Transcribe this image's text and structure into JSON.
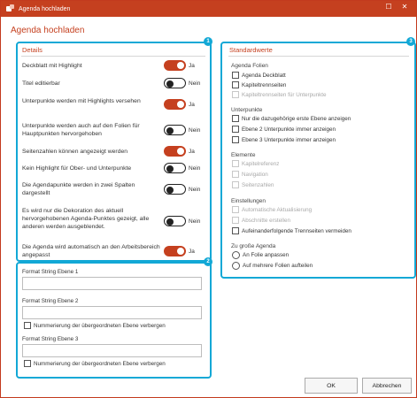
{
  "window": {
    "title": "Agenda hochladen",
    "max_glyph": "☐",
    "close_glyph": "✕"
  },
  "dialog": {
    "heading": "Agenda hochladen"
  },
  "badges": {
    "one": "1",
    "two": "2",
    "three": "3"
  },
  "details": {
    "title": "Details",
    "rows": [
      {
        "label": "Deckblatt mit Highlight",
        "on": true,
        "state": "Ja"
      },
      {
        "label": "Titel editierbar",
        "on": false,
        "state": "Nein"
      },
      {
        "label": "Unterpunkte werden mit Highlights versehen",
        "on": true,
        "state": "Ja"
      },
      {
        "label": "Unterpunkte werden auch auf den Folien für Hauptpunkten hervorgehoben",
        "on": false,
        "state": "Nein"
      },
      {
        "label": "Seitenzahlen können angezeigt werden",
        "on": true,
        "state": "Ja"
      },
      {
        "label": "Kein Highlight für Ober- und Unterpunkte",
        "on": false,
        "state": "Nein"
      },
      {
        "label": "Die Agendapunkte werden in zwei Spalten dargestellt",
        "on": false,
        "state": "Nein"
      },
      {
        "label": "Es wird nur die Dekoration des aktuell hervorgehobenen Agenda-Punktes gezeigt, alle anderen werden ausgeblendet.",
        "on": false,
        "state": "Nein"
      },
      {
        "label": "Die Agenda wird automatisch an den Arbeitsbereich angepasst",
        "on": true,
        "state": "Ja"
      }
    ]
  },
  "format": {
    "level1_label": "Format String Ebene 1",
    "level1_value": "",
    "level2_label": "Format String Ebene 2",
    "level2_value": "",
    "level2_hide": "Nummerierung der übergeordneten Ebene verbergen",
    "level3_label": "Format String Ebene 3",
    "level3_value": "",
    "level3_hide": "Nummerierung der übergeordneten Ebene verbergen"
  },
  "standard": {
    "title": "Standardwerte",
    "folien": {
      "label": "Agenda Folien",
      "deckblatt": "Agenda Deckblatt",
      "kapiteltrenn": "Kapiteltrennseiten",
      "kapiteltrenn_unter": "Kapiteltrennseiten für Unterpunkte"
    },
    "unterpunkte": {
      "label": "Unterpunkte",
      "erste": "Nur die dazugehörige erste Ebene anzeigen",
      "ebene2": "Ebene 2 Unterpunkte immer anzeigen",
      "ebene3": "Ebene 3 Unterpunkte immer anzeigen"
    },
    "elemente": {
      "label": "Elemente",
      "kapitelreferenz": "Kapitelreferenz",
      "navigation": "Navigation",
      "seitenzahlen": "Seitenzahlen"
    },
    "einstellungen": {
      "label": "Einstellungen",
      "auto": "Automatische Aktualisierung",
      "abschnitte": "Abschnitte erstellen",
      "trenn": "Aufeinanderfolgende Trennseiten vermeiden"
    },
    "zugross": {
      "label": "Zu große Agenda",
      "anpassen": "An Folie anpassen",
      "aufteilen": "Auf mehrere Folien aufteilen"
    }
  },
  "buttons": {
    "ok": "OK",
    "cancel": "Abbrechen"
  },
  "colors": {
    "accent": "#c5401f",
    "highlight": "#12a8d6"
  }
}
